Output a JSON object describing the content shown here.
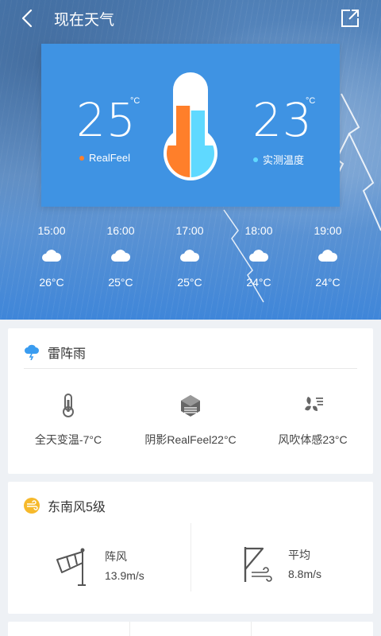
{
  "header": {
    "title": "现在天气",
    "back_icon": "chevron-left-icon",
    "share_icon": "share-external-icon"
  },
  "current": {
    "realfeel_value": "25",
    "realfeel_unit": "°C",
    "realfeel_label": "RealFeel",
    "measured_value": "23",
    "measured_unit": "°C",
    "measured_label": "实测温度",
    "colors": {
      "realfeel": "#ff7f2a",
      "measured": "#5fd9ff"
    }
  },
  "hourly": [
    {
      "time": "15:00",
      "icon": "cloud-icon",
      "temp": "26°C"
    },
    {
      "time": "16:00",
      "icon": "cloud-icon",
      "temp": "25°C"
    },
    {
      "time": "17:00",
      "icon": "cloud-icon",
      "temp": "25°C"
    },
    {
      "time": "18:00",
      "icon": "cloud-icon",
      "temp": "24°C"
    },
    {
      "time": "19:00",
      "icon": "cloud-icon",
      "temp": "24°C"
    }
  ],
  "condition": {
    "title": "雷阵雨",
    "icon": "thunderstorm-icon",
    "stats": [
      {
        "icon": "thermometer-icon",
        "label": "全天变温-7°C"
      },
      {
        "icon": "shade-cube-icon",
        "label": "阴影RealFeel22°C"
      },
      {
        "icon": "wind-fan-icon",
        "label": "风吹体感23°C"
      }
    ]
  },
  "wind": {
    "title": "东南风5级",
    "icon": "wind-badge-icon",
    "gust_label": "阵风",
    "gust_value": "13.9m/s",
    "avg_label": "平均",
    "avg_value": "8.8m/s"
  }
}
